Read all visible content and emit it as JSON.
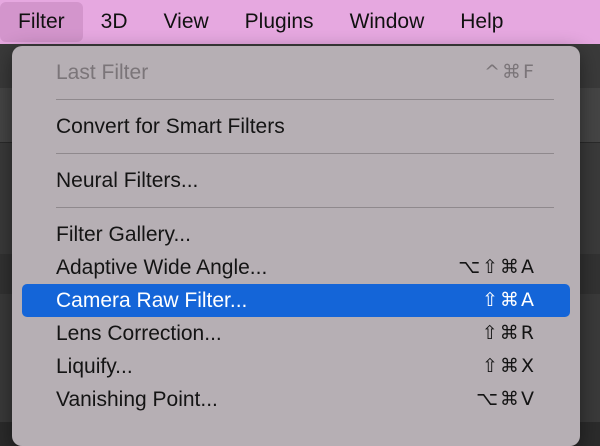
{
  "menubar": {
    "items": [
      {
        "label": "Filter",
        "open": true
      },
      {
        "label": "3D"
      },
      {
        "label": "View"
      },
      {
        "label": "Plugins"
      },
      {
        "label": "Window"
      },
      {
        "label": "Help"
      }
    ]
  },
  "filter_menu": {
    "groups": [
      [
        {
          "label": "Last Filter",
          "shortcut": "^⌘F",
          "disabled": true
        }
      ],
      [
        {
          "label": "Convert for Smart Filters",
          "shortcut": ""
        }
      ],
      [
        {
          "label": "Neural Filters...",
          "shortcut": ""
        }
      ],
      [
        {
          "label": "Filter Gallery...",
          "shortcut": ""
        },
        {
          "label": "Adaptive Wide Angle...",
          "shortcut": "⌥⇧⌘A"
        },
        {
          "label": "Camera Raw Filter...",
          "shortcut": "⇧⌘A",
          "selected": true
        },
        {
          "label": "Lens Correction...",
          "shortcut": "⇧⌘R"
        },
        {
          "label": "Liquify...",
          "shortcut": "⇧⌘X"
        },
        {
          "label": "Vanishing Point...",
          "shortcut": "⌥⌘V"
        }
      ]
    ]
  },
  "colors": {
    "menubar_bg": "#e6a8e0",
    "menu_bg": "#b6afb4",
    "selection": "#1465d8",
    "disabled_text": "#7b7579"
  }
}
